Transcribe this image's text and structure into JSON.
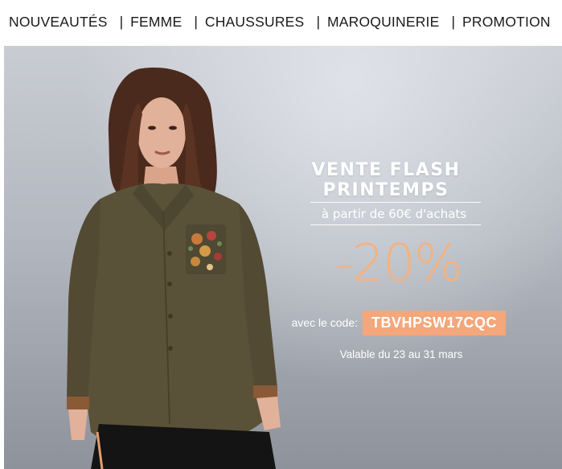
{
  "nav": {
    "items": [
      {
        "label": "NOUVEAUTÉS"
      },
      {
        "label": "FEMME"
      },
      {
        "label": "CHAUSSURES"
      },
      {
        "label": "MAROQUINERIE"
      },
      {
        "label": "PROMOTION"
      }
    ],
    "separator": "|"
  },
  "banner": {
    "headline": "VENTE FLASH PRINTEMPS",
    "condition": "à partir de 60€ d'achats",
    "discount": "-20%",
    "code_label": "avec le code:",
    "code": "TBVHPSW17CQC",
    "validity": "Valable du 23 au 31 mars",
    "colors": {
      "accent": "#f4b27e",
      "code_background": "#f3a77a",
      "background": "#b3b7bf",
      "shirt": "#5a5238"
    }
  }
}
